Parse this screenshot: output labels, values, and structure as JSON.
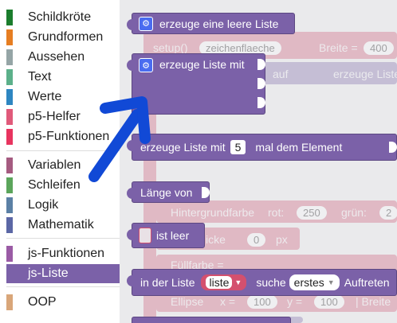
{
  "toolbox": {
    "categories": [
      {
        "label": "Schildkröte",
        "color": "#1b7d2d"
      },
      {
        "label": "Grundformen",
        "color": "#e67e22"
      },
      {
        "label": "Aussehen",
        "color": "#95a5a6"
      },
      {
        "label": "Text",
        "color": "#5cb08a"
      },
      {
        "label": "Werte",
        "color": "#2e86c1"
      },
      {
        "label": "p5-Helfer",
        "color": "#e05a7a"
      },
      {
        "label": "p5-Funktionen",
        "color": "#e8345f"
      },
      {
        "label": "Variablen",
        "color": "#a55b80"
      },
      {
        "label": "Schleifen",
        "color": "#5ba55b"
      },
      {
        "label": "Logik",
        "color": "#5b80a5"
      },
      {
        "label": "Mathematik",
        "color": "#5b67a5"
      },
      {
        "label": "js-Funktionen",
        "color": "#9a5ba5"
      },
      {
        "label": "js-Liste",
        "color": "#7b61a8",
        "selected": true
      },
      {
        "label": "OOP",
        "color": "#d9a679"
      }
    ]
  },
  "background": {
    "setup_label": "setup()",
    "canvas_dropdown": "zeichenflaeche",
    "width_label": "Breite =",
    "width_value": "400",
    "auf_label": "auf",
    "erzeuge_liste_faded": "erzeuge Liste",
    "hintergrundfarbe": "Hintergrundfarbe",
    "rot_label": "rot:",
    "rot_value": "250",
    "gruen_label": "grün:",
    "gruen_value": "2",
    "dicke_label": "icke",
    "dicke_value": "0",
    "px_label": "px",
    "fuellfarbe_label": "Füllfarbe =",
    "ellipse_label": "Ellipse",
    "x_label": "x =",
    "x_value": "100",
    "y_label": "y =",
    "y_value": "100",
    "breite_label": "| Breite"
  },
  "flyout": {
    "b1": {
      "label": "erzeuge eine leere Liste"
    },
    "b2": {
      "label": "erzeuge Liste mit"
    },
    "b3": {
      "prefix": "erzeuge Liste mit",
      "count": "5",
      "suffix": "mal dem Element"
    },
    "b4": {
      "label": "Länge von"
    },
    "b5": {
      "label": "ist leer"
    },
    "b6": {
      "prefix": "in der Liste",
      "list_var": "liste",
      "search_label": "suche",
      "position": "erstes",
      "suffix": "Auftreten"
    }
  },
  "annotation": {
    "arrow_color": "#1149d6"
  }
}
